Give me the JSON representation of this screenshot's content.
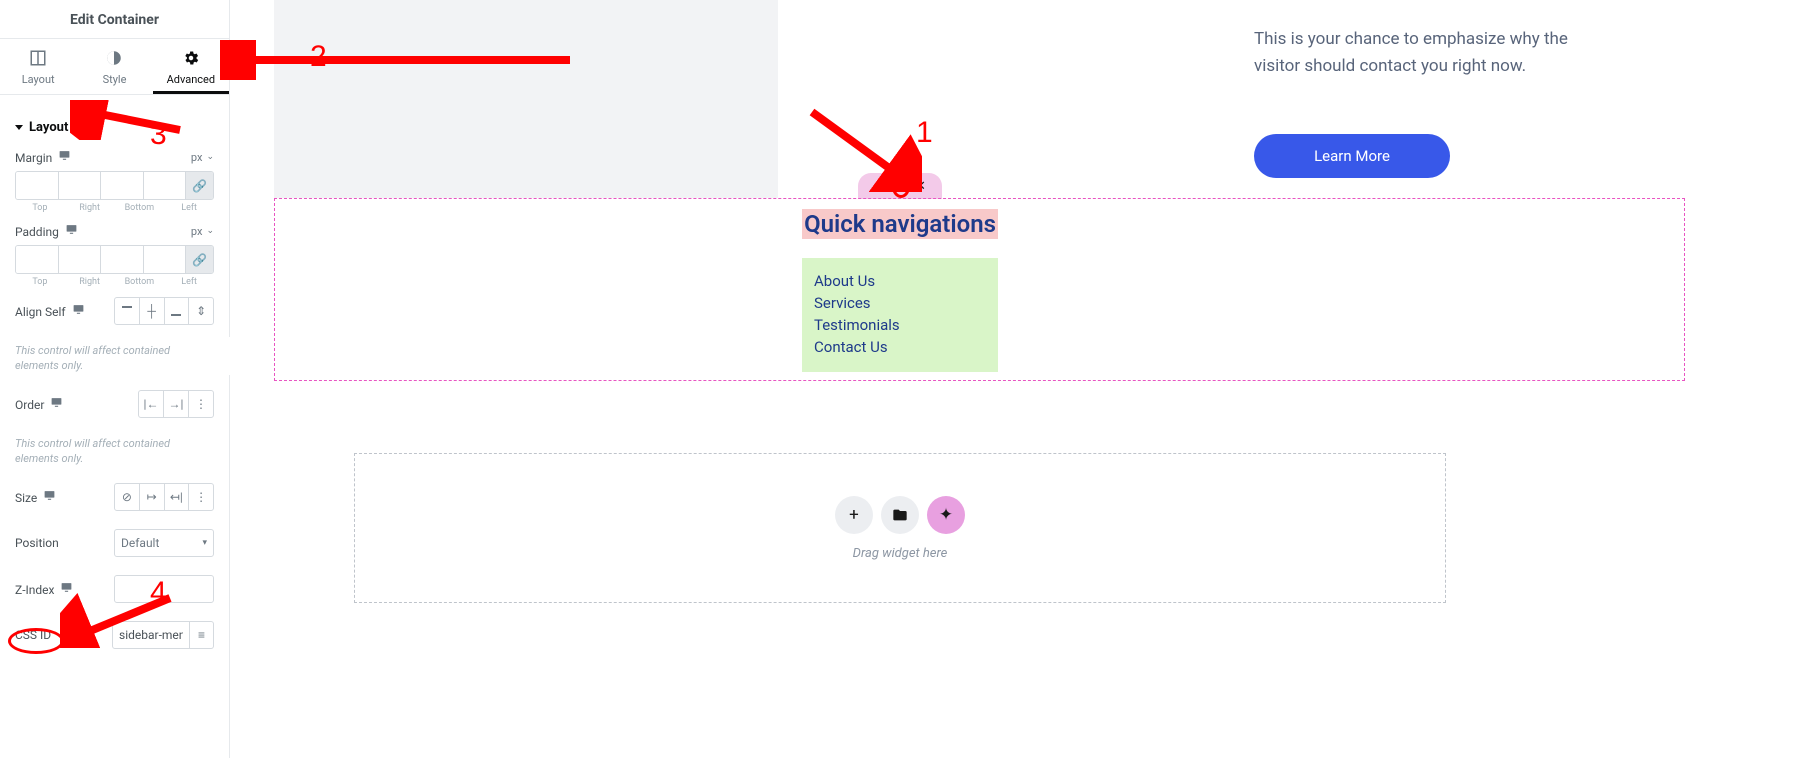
{
  "panel": {
    "title": "Edit Container",
    "tabs": {
      "layout": "Layout",
      "style": "Style",
      "advanced": "Advanced"
    },
    "layout_section": "Layout",
    "margin": {
      "label": "Margin",
      "unit": "px",
      "sides": {
        "top": "Top",
        "right": "Right",
        "bottom": "Bottom",
        "left": "Left"
      }
    },
    "padding": {
      "label": "Padding",
      "unit": "px"
    },
    "align_self": "Align Self",
    "help1": "This control will affect contained elements only.",
    "order": "Order",
    "help2": "This control will affect contained elements only.",
    "size": "Size",
    "position": {
      "label": "Position",
      "value": "Default"
    },
    "zindex": "Z-Index",
    "cssid": {
      "label": "CSS ID",
      "value": "sidebar-men"
    }
  },
  "canvas": {
    "promo": "This is your chance to emphasize why the visitor should contact you right now.",
    "learn_more": "Learn More",
    "quick_nav_title": "Quick navigations",
    "quick_nav_items": [
      "About Us",
      "Services",
      "Testimonials",
      "Contact Us"
    ],
    "drag_hint": "Drag widget here"
  },
  "annotations": {
    "a1": "1",
    "a2": "2",
    "a3": "3",
    "a4": "4"
  }
}
